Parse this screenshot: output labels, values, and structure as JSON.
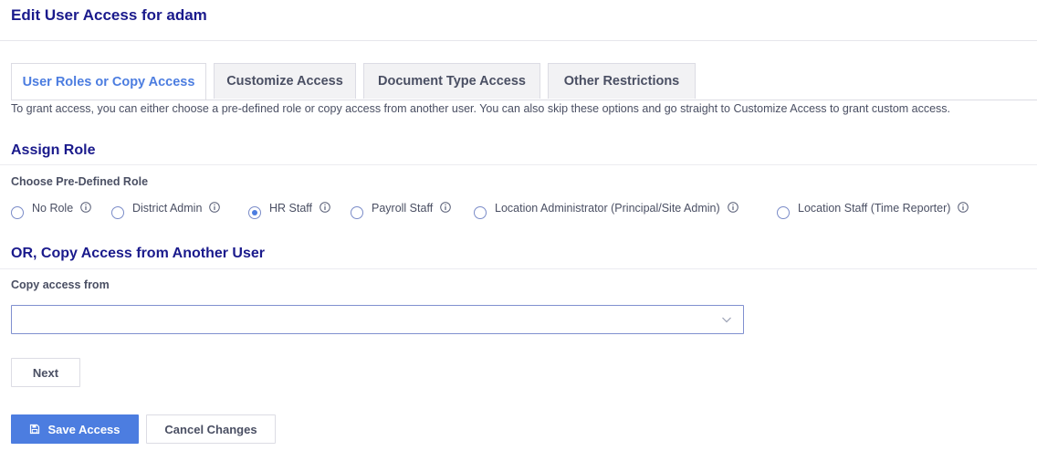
{
  "page": {
    "title": "Edit User Access for adam"
  },
  "tabs": [
    {
      "label": "User Roles or Copy Access",
      "active": true
    },
    {
      "label": "Customize Access",
      "active": false
    },
    {
      "label": "Document Type Access",
      "active": false
    },
    {
      "label": "Other Restrictions",
      "active": false
    }
  ],
  "intro": "To grant access, you can either choose a pre-defined role or copy access from another user. You can also skip these options and go straight to Customize Access to grant custom access.",
  "assign_role": {
    "title": "Assign Role",
    "label": "Choose Pre-Defined Role",
    "options": [
      {
        "label": "No Role",
        "checked": false
      },
      {
        "label": "District Admin",
        "checked": false
      },
      {
        "label": "HR Staff",
        "checked": true
      },
      {
        "label": "Payroll Staff",
        "checked": false
      },
      {
        "label": "Location Administrator (Principal/Site Admin)",
        "checked": false
      },
      {
        "label": "Location Staff (Time Reporter)",
        "checked": false
      }
    ]
  },
  "copy_access": {
    "title": "OR, Copy Access from Another User",
    "label": "Copy access from",
    "value": ""
  },
  "buttons": {
    "next": "Next",
    "save": "Save Access",
    "cancel": "Cancel Changes"
  },
  "colors": {
    "accent": "#4c7de0",
    "heading": "#1a1a8c",
    "text": "#4a4f63"
  },
  "icons": {
    "info": "info-circle-icon",
    "save": "floppy-disk-icon",
    "dropdown": "chevron-down-icon"
  }
}
